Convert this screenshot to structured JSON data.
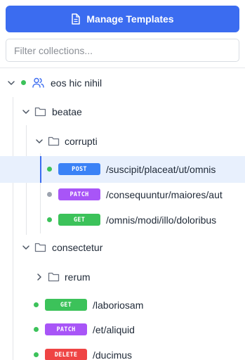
{
  "header": {
    "manage_label": "Manage Templates",
    "filter_placeholder": "Filter collections..."
  },
  "colors": {
    "accent": "#3b6cf0",
    "get": "#3cc25a",
    "post": "#3b82f6",
    "patch": "#a855f7",
    "delete": "#ef4444"
  },
  "tree": {
    "collection": {
      "name": "eos hic nihil",
      "icon": "users-icon",
      "status": "green"
    },
    "folder_beatae": {
      "name": "beatae"
    },
    "folder_corrupti": {
      "name": "corrupti"
    },
    "req1": {
      "method": "POST",
      "path": "/suscipit/placeat/ut/omnis",
      "status": "green",
      "selected": true
    },
    "req2": {
      "method": "PATCH",
      "path": "/consequuntur/maiores/aut",
      "status": "gray"
    },
    "req3": {
      "method": "GET",
      "path": "/omnis/modi/illo/doloribus",
      "status": "green"
    },
    "folder_consectetur": {
      "name": "consectetur"
    },
    "folder_rerum": {
      "name": "rerum"
    },
    "req4": {
      "method": "GET",
      "path": "/laboriosam",
      "status": "green"
    },
    "req5": {
      "method": "PATCH",
      "path": "/et/aliquid",
      "status": "green"
    },
    "req6": {
      "method": "DELETE",
      "path": "/ducimus",
      "status": "green"
    }
  }
}
